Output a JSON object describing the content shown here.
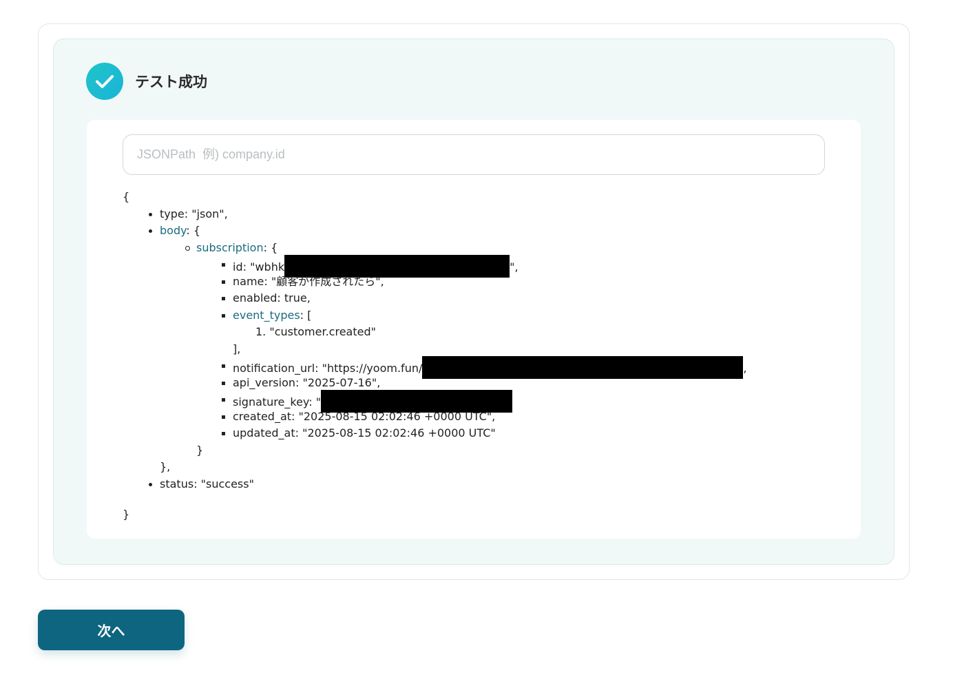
{
  "status": {
    "title": "テスト成功",
    "icon": "check-icon",
    "accent_color": "#20c4c8"
  },
  "search": {
    "placeholder": "JSONPath  例) company.id",
    "value": ""
  },
  "json": {
    "open_brace": "{",
    "close_brace": "}",
    "type": {
      "key": "type",
      "sep": ": ",
      "value": "\"json\","
    },
    "body": {
      "key": "body",
      "open": ": {",
      "close": "},"
    },
    "subscription": {
      "key": "subscription",
      "open": ": {",
      "close": "}"
    },
    "id": {
      "key": "id",
      "sep": ": ",
      "value_prefix": "\"wbhk",
      "value_suffix": "\","
    },
    "name": {
      "key": "name",
      "sep": ": ",
      "value": "\"顧客が作成されたら\","
    },
    "enabled": {
      "key": "enabled",
      "sep": ": ",
      "value": "true,"
    },
    "event_types": {
      "key": "event_types",
      "open": ": [",
      "close": "],",
      "items": [
        "\"customer.created\""
      ]
    },
    "notification_url": {
      "key": "notification_url",
      "sep": ": ",
      "value_prefix": "\"https://yoom.fun/",
      "value_suffix": ","
    },
    "api_version": {
      "key": "api_version",
      "sep": ": ",
      "value": "\"2025-07-16\","
    },
    "signature_key": {
      "key": "signature_key",
      "sep": ": ",
      "value_prefix": "\""
    },
    "created_at": {
      "key": "created_at",
      "sep": ": ",
      "value": "\"2025-08-15 02:02:46 +0000 UTC\","
    },
    "updated_at": {
      "key": "updated_at",
      "sep": ": ",
      "value": "\"2025-08-15 02:02:46 +0000 UTC\""
    },
    "status": {
      "key": "status",
      "sep": ": ",
      "value": "\"success\""
    }
  },
  "footer": {
    "next_label": "次へ",
    "button_color": "#0e6580"
  }
}
